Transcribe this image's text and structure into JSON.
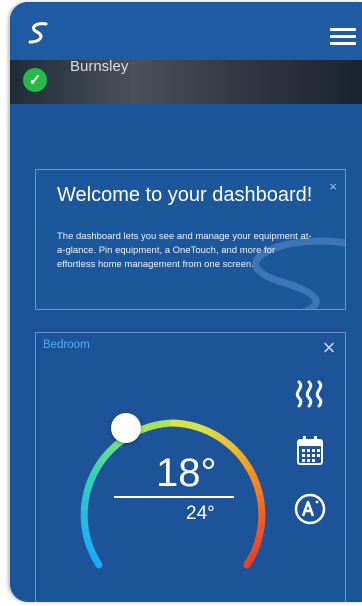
{
  "header": {
    "logo_icon": "swirl-logo-icon",
    "menu_icon": "hamburger-menu-icon"
  },
  "banner": {
    "location": "Burnsley",
    "status_icon": "check-circle-icon",
    "status_color": "#28b84a"
  },
  "welcome": {
    "title": "Welcome to your dashboard!",
    "body": "The dashboard lets you see and manage your equipment at-a-glance. Pin equipment, a OneTouch, and more for effortless home management from one screen.",
    "close_label": "×"
  },
  "thermostat": {
    "name": "Bedroom",
    "close_label": "×",
    "current_temp": "18°",
    "setpoint_temp": "24°",
    "mode_icons": [
      "heat-icon",
      "schedule-calendar-icon",
      "auto-mode-icon"
    ],
    "name_color": "#4fb2f0"
  },
  "colors": {
    "background": "#1b5499",
    "accent": "#4fb2f0"
  }
}
